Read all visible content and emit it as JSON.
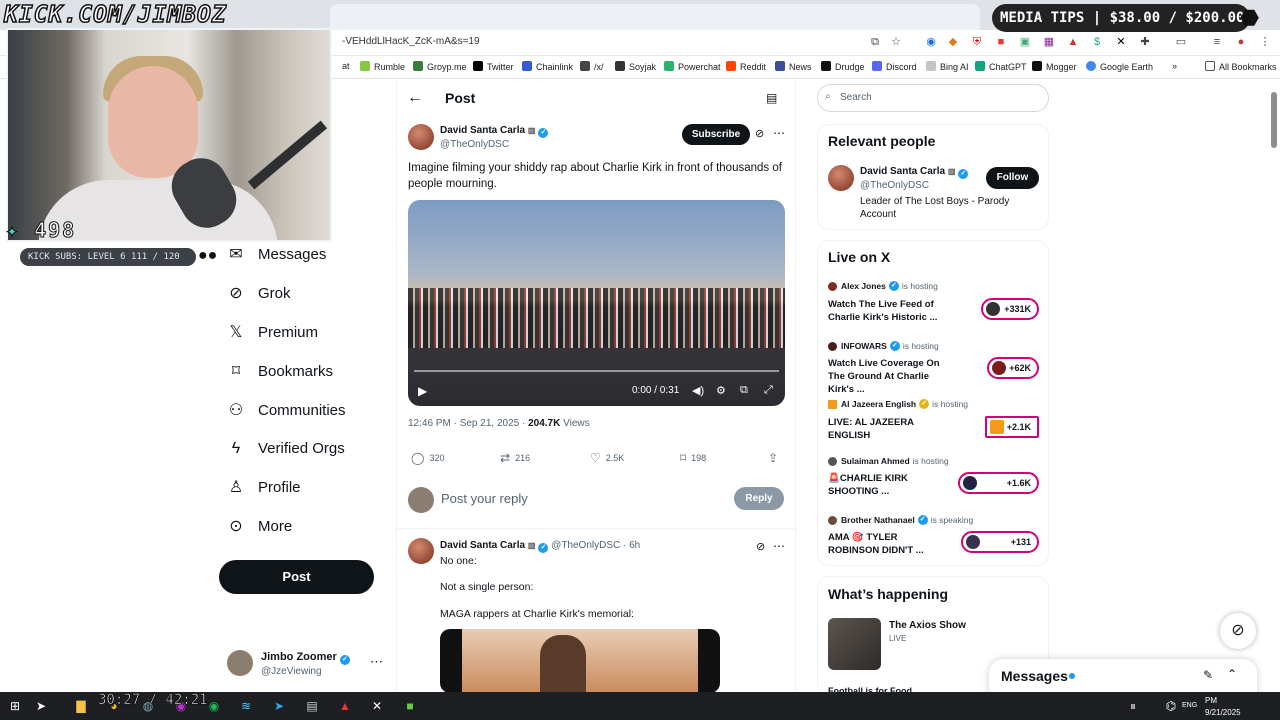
{
  "overlay": {
    "kick_url": "KICK.COM/JIMBOZ",
    "media_tips": "MEDIA TIPS | $38.00 / $200.00",
    "viewer_count": "498",
    "subs_level": "KICK SUBS: LEVEL 6 111 / 120",
    "stream_clock": "30:27 / 42:21"
  },
  "browser": {
    "url": "-VEHddLlHacK_ZcK-mA&s=19",
    "all_bookmarks": "All Bookmarks",
    "bookmarks": [
      {
        "label": "at",
        "color": "#555555"
      },
      {
        "label": "Rumble",
        "color": "#85c742"
      },
      {
        "label": "Groyp.me",
        "color": "#3a7d3a"
      },
      {
        "label": "Twitter",
        "color": "#000000"
      },
      {
        "label": "Chainlink",
        "color": "#375bd2"
      },
      {
        "label": "/x/",
        "color": "#444444"
      },
      {
        "label": "Soyjak",
        "color": "#333333"
      },
      {
        "label": "Powerchat",
        "color": "#2bb56a"
      },
      {
        "label": "Reddit",
        "color": "#ff4500"
      },
      {
        "label": "News",
        "color": "#3c4d9a"
      },
      {
        "label": "Drudge",
        "color": "#111111"
      },
      {
        "label": "Discord",
        "color": "#5865f2"
      },
      {
        "label": "Bing AI",
        "color": "#c4c4c4"
      },
      {
        "label": "ChatGPT",
        "color": "#10a37f"
      },
      {
        "label": "Mogger",
        "color": "#111111"
      },
      {
        "label": "Google Earth",
        "color": "#4285f4"
      }
    ]
  },
  "nav": {
    "items": [
      {
        "label": "Messages",
        "icon": "mail-icon"
      },
      {
        "label": "Grok",
        "icon": "grok-icon"
      },
      {
        "label": "Premium",
        "icon": "x-logo-icon"
      },
      {
        "label": "Bookmarks",
        "icon": "bookmark-icon"
      },
      {
        "label": "Communities",
        "icon": "people-icon"
      },
      {
        "label": "Verified Orgs",
        "icon": "lightning-icon"
      },
      {
        "label": "Profile",
        "icon": "person-icon"
      },
      {
        "label": "More",
        "icon": "more-circle-icon"
      }
    ],
    "post_button": "Post",
    "profile": {
      "name": "Jimbo Zoomer",
      "handle": "@JzeViewing"
    }
  },
  "post": {
    "header_title": "Post",
    "author_name": "David Santa Carla",
    "author_handle": "@TheOnlyDSC",
    "subscribe": "Subscribe",
    "text": "Imagine filming your shiddy rap about Charlie Kirk in front of thousands of people mourning.",
    "video_time": "0:00 / 0:31",
    "timestamp": "12:46 PM · Sep 21, 2025 · ",
    "views_count": "204.7K",
    "views_label": " Views",
    "stats": {
      "replies": "320",
      "reposts": "216",
      "likes": "2.5K",
      "bookmarks": "198"
    },
    "reply_placeholder": "Post your reply",
    "reply_button": "Reply"
  },
  "reply": {
    "author_name": "David Santa Carla",
    "author_handle": "@TheOnlyDSC · 6h",
    "lines": [
      "No one:",
      "Not a single person:",
      "MAGA rappers at Charlie Kirk's memorial:"
    ]
  },
  "sidebar": {
    "search_placeholder": "Search",
    "relevant_title": "Relevant people",
    "relevant": {
      "name": "David Santa Carla",
      "handle": "@TheOnlyDSC",
      "bio": "Leader of The Lost Boys - Parody Account",
      "follow": "Follow"
    },
    "live_title": "Live on X",
    "live": [
      {
        "host": "Alex Jones",
        "status": "is hosting",
        "title": "Watch The Live Feed of Charlie Kirk's Historic ...",
        "count": "+331K"
      },
      {
        "host": "INFOWARS",
        "status": "is hosting",
        "title": "Watch Live Coverage On The Ground At Charlie Kirk's ...",
        "count": "+62K"
      },
      {
        "host": "Al Jazeera English",
        "status": "is hosting",
        "title": "LIVE: AL JAZEERA ENGLISH",
        "count": "+2.1K"
      },
      {
        "host": "Sulaiman Ahmed",
        "status": "is hosting",
        "title": "🚨CHARLIE KIRK SHOOTING ...",
        "count": "+1.6K"
      },
      {
        "host": "Brother Nathanael",
        "status": "is speaking",
        "title": "AMA 🎯 TYLER ROBINSON DIDN'T ...",
        "count": "+131"
      }
    ],
    "happening_title": "What’s happening",
    "happening": {
      "title": "The Axios Show",
      "subtitle": "LIVE",
      "next": "Football is for Food"
    },
    "messages_drawer": "Messages"
  },
  "taskbar": {
    "lang": "ENG",
    "time": "PM",
    "date": "9/21/2025"
  },
  "colors": {
    "accent": "#1d9bf0",
    "live_pink": "#d3007e",
    "dark": "#0f1419"
  }
}
